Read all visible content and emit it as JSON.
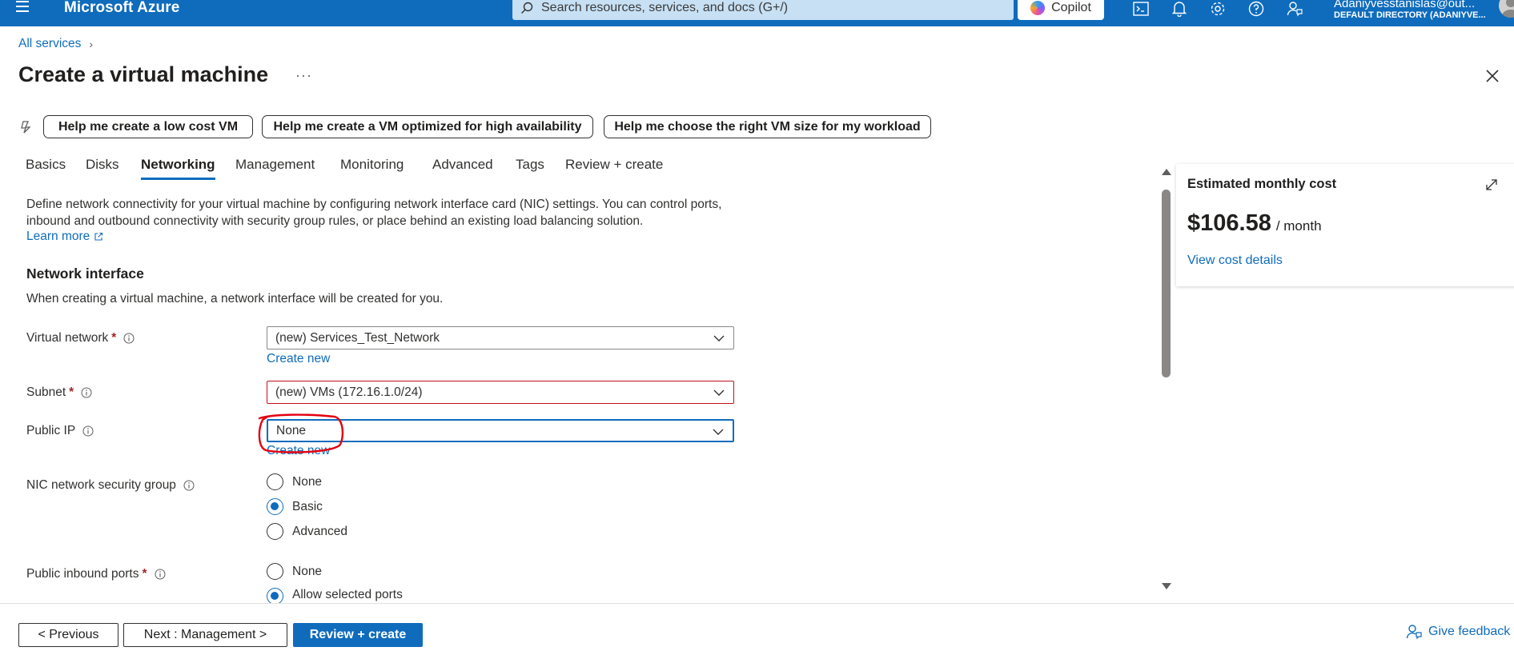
{
  "topbar": {
    "brand": "Microsoft Azure",
    "search_placeholder": "Search resources, services, and docs (G+/)",
    "copilot_label": "Copilot",
    "account_email": "Adaniyvesstanislas@out...",
    "account_directory": "DEFAULT DIRECTORY (ADANIYVE..."
  },
  "breadcrumb": {
    "all_services": "All services"
  },
  "page": {
    "title": "Create a virtual machine",
    "more": "···"
  },
  "suggestions": [
    "Help me create a low cost VM",
    "Help me create a VM optimized for high availability",
    "Help me choose the right VM size for my workload"
  ],
  "tabs": [
    "Basics",
    "Disks",
    "Networking",
    "Management",
    "Monitoring",
    "Advanced",
    "Tags",
    "Review + create"
  ],
  "active_tab": "Networking",
  "intro": {
    "description": "Define network connectivity for your virtual machine by configuring network interface card (NIC) settings. You can control ports, inbound and outbound connectivity with security group rules, or place behind an existing load balancing solution.",
    "learn_more": "Learn more"
  },
  "network_interface": {
    "heading": "Network interface",
    "subtext": "When creating a virtual machine, a network interface will be created for you."
  },
  "fields": {
    "virtual_network": {
      "label": "Virtual network",
      "required": "*",
      "value": "(new) Services_Test_Network",
      "create_new": "Create new"
    },
    "subnet": {
      "label": "Subnet",
      "required": "*",
      "value": "(new) VMs (172.16.1.0/24)"
    },
    "public_ip": {
      "label": "Public IP",
      "value": "None",
      "create_new": "Create new"
    },
    "nic_nsg": {
      "label": "NIC network security group",
      "options": [
        "None",
        "Basic",
        "Advanced"
      ],
      "selected": "Basic"
    },
    "public_inbound_ports": {
      "label": "Public inbound ports",
      "required": "*",
      "options": [
        "None",
        "Allow selected ports"
      ],
      "selected": "Allow selected ports"
    }
  },
  "cost": {
    "title": "Estimated monthly cost",
    "amount": "$106.58",
    "period": "/ month",
    "details_link": "View cost details"
  },
  "footer": {
    "previous": "< Previous",
    "next": "Next : Management >",
    "review": "Review + create",
    "feedback": "Give feedback"
  },
  "colors": {
    "accent": "#0f6cbd",
    "error": "#c50f1f",
    "annotation": "#e3000f"
  }
}
